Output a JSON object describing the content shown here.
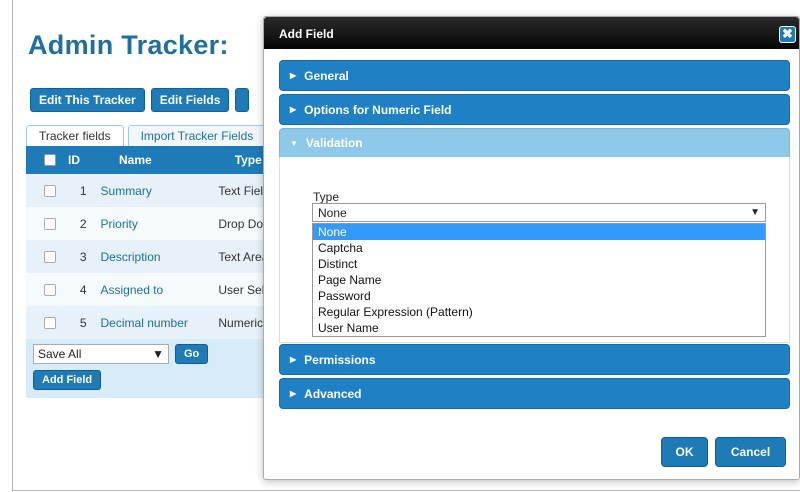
{
  "page": {
    "title": "Admin Tracker:",
    "toolbar": {
      "edit_tracker": "Edit This Tracker",
      "edit_fields": "Edit Fields"
    },
    "tabs": [
      {
        "label": "Tracker fields"
      },
      {
        "label": "Import Tracker Fields"
      }
    ],
    "table": {
      "headers": {
        "id": "ID",
        "name": "Name",
        "type": "Type"
      },
      "rows": [
        {
          "id": "1",
          "name": "Summary",
          "type": "Text Field"
        },
        {
          "id": "2",
          "name": "Priority",
          "type": "Drop Down"
        },
        {
          "id": "3",
          "name": "Description",
          "type": "Text Area"
        },
        {
          "id": "4",
          "name": "Assigned to",
          "type": "User Selector"
        },
        {
          "id": "5",
          "name": "Decimal number",
          "type": "Numeric Field"
        }
      ]
    },
    "bulk_action": {
      "selected": "Save All",
      "go_label": "Go"
    },
    "add_field_label": "Add Field"
  },
  "modal": {
    "title": "Add Field",
    "close_glyph": "✖",
    "sections": {
      "general": "General",
      "numeric_options": "Options for Numeric Field",
      "validation": "Validation",
      "permissions": "Permissions",
      "advanced": "Advanced"
    },
    "validation": {
      "type_label": "Type",
      "selected": "None",
      "options": [
        "None",
        "Captcha",
        "Distinct",
        "Page Name",
        "Password",
        "Regular Expression (Pattern)",
        "User Name"
      ]
    },
    "ok_label": "OK",
    "cancel_label": "Cancel"
  },
  "colors": {
    "accent": "#1f7ab8",
    "title_blue": "#1f6f9f",
    "section_open": "#8fc9ea",
    "highlight": "#3399ff"
  }
}
